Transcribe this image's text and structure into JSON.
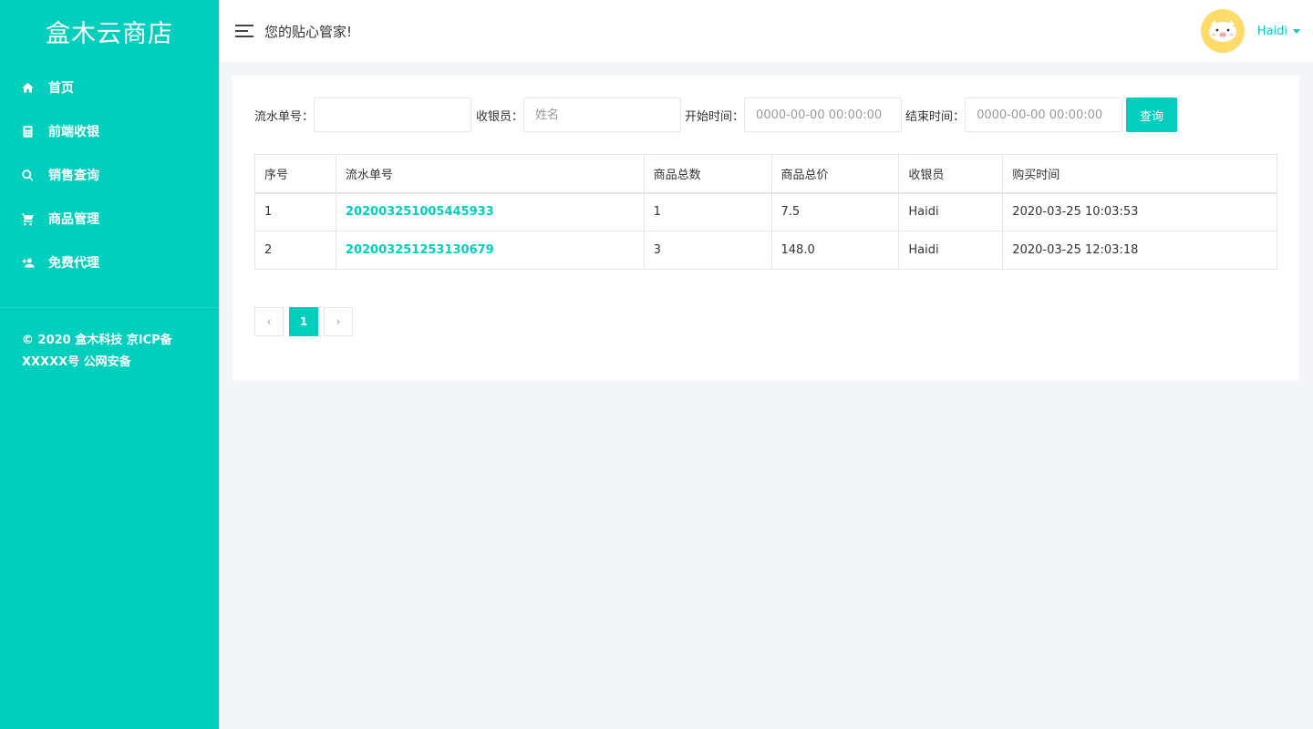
{
  "sidebar": {
    "brand": "盒木云商店",
    "items": [
      {
        "label": "首页",
        "icon": "home-icon"
      },
      {
        "label": "前端收银",
        "icon": "calculator-icon"
      },
      {
        "label": "销售查询",
        "icon": "search-icon"
      },
      {
        "label": "商品管理",
        "icon": "cart-icon"
      },
      {
        "label": "免费代理",
        "icon": "add-user-icon"
      }
    ],
    "footer_line1": "© 2020 盒木科技 京ICP备",
    "footer_line2": "XXXXX号 公网安备"
  },
  "header": {
    "greeting": "您的贴心管家!",
    "username": "Haidi"
  },
  "filters": {
    "order_no_label": "流水单号：",
    "order_no_value": "",
    "cashier_label": "收银员：",
    "cashier_placeholder": "姓名",
    "start_label": "开始时间：",
    "start_placeholder": "0000-00-00 00:00:00",
    "end_label": "结束时间：",
    "end_placeholder": "0000-00-00 00:00:00",
    "query_label": "查询"
  },
  "table": {
    "columns": [
      "序号",
      "流水单号",
      "商品总数",
      "商品总价",
      "收银员",
      "购买时间"
    ],
    "rows": [
      {
        "index": "1",
        "order_no": "202003251005445933",
        "qty": "1",
        "total": "7.5",
        "cashier": "Haidi",
        "time": "2020-03-25 10:03:53"
      },
      {
        "index": "2",
        "order_no": "202003251253130679",
        "qty": "3",
        "total": "148.0",
        "cashier": "Haidi",
        "time": "2020-03-25 12:03:18"
      }
    ]
  },
  "pagination": {
    "prev": "‹",
    "current": "1",
    "next": "›"
  },
  "colors": {
    "accent": "#00cfbd",
    "background": "#f4f5f9",
    "avatar": "#fddc6a"
  }
}
